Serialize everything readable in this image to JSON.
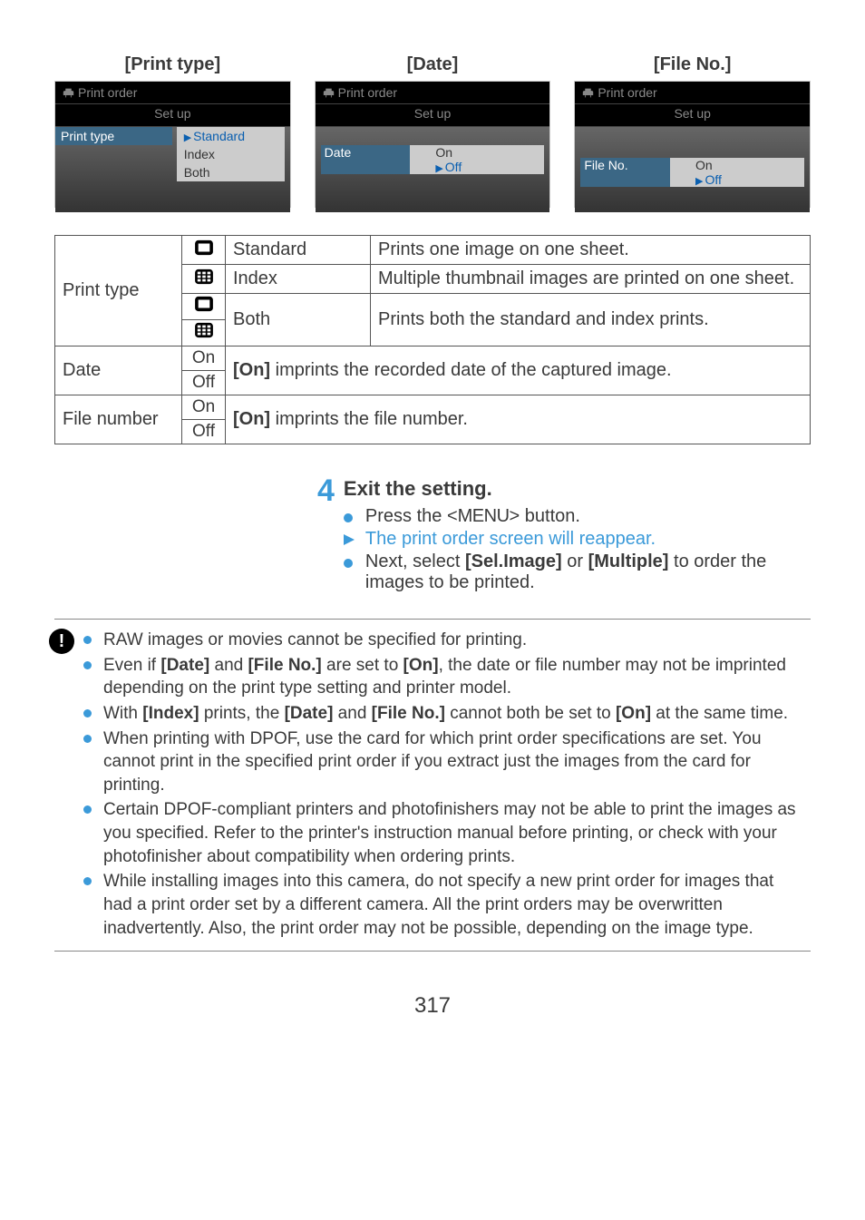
{
  "headers": {
    "print_type": "[Print type]",
    "date": "[Date]",
    "file_no": "[File No.]"
  },
  "screen": {
    "title": "Print order",
    "subtitle": "Set up",
    "print_type_label": "Print type",
    "opts_pt": [
      "Standard",
      "Index",
      "Both"
    ],
    "date_label": "Date",
    "file_label": "File No.",
    "on": "On",
    "off": "Off"
  },
  "table": {
    "print_type": "Print type",
    "standard": "Standard",
    "standard_desc": "Prints one image on one sheet.",
    "index": "Index",
    "index_desc": "Multiple thumbnail images are printed on one sheet.",
    "both": "Both",
    "both_desc": "Prints both the standard and index prints.",
    "date": "Date",
    "date_desc_prefix": "[On]",
    "date_desc": " imprints the recorded date of the captured image.",
    "file_number": "File number",
    "file_desc_prefix": "[On]",
    "file_desc": " imprints the file number.",
    "on": "On",
    "off": "Off"
  },
  "step": {
    "num": "4",
    "head": "Exit the setting.",
    "l1a": "Press the <",
    "l1b": "MENU",
    "l1c": "> button.",
    "l2": "The print order screen will reappear.",
    "l3a": "Next, select ",
    "l3b": "[Sel.Image]",
    "l3c": " or ",
    "l3d": "[Multiple]",
    "l3e": " to order the images to be printed."
  },
  "warn": {
    "w1": "RAW images or movies cannot be specified for printing.",
    "w2a": "Even if ",
    "w2b": "[Date]",
    "w2c": " and ",
    "w2d": "[File No.]",
    "w2e": " are set to ",
    "w2f": "[On]",
    "w2g": ", the date or file number may not be imprinted depending on the print type setting and printer model.",
    "w3a": "With ",
    "w3b": "[Index]",
    "w3c": " prints, the ",
    "w3d": "[Date]",
    "w3e": " and ",
    "w3f": "[File No.]",
    "w3g": " cannot both be set to ",
    "w3h": "[On]",
    "w3i": " at the same time.",
    "w4": "When printing with DPOF, use the card for which print order specifications are set. You cannot print in the specified print order if you extract just the images from the card for printing.",
    "w5": "Certain DPOF-compliant printers and photofinishers may not be able to print the images as you specified. Refer to the printer's instruction manual before printing, or check with your photofinisher about compatibility when ordering prints.",
    "w6": "While installing images into this camera, do not specify a new print order for images that had a print order set by a different camera. All the print orders may be overwritten inadvertently. Also, the print order may not be possible, depending on the image type."
  },
  "page": "317"
}
